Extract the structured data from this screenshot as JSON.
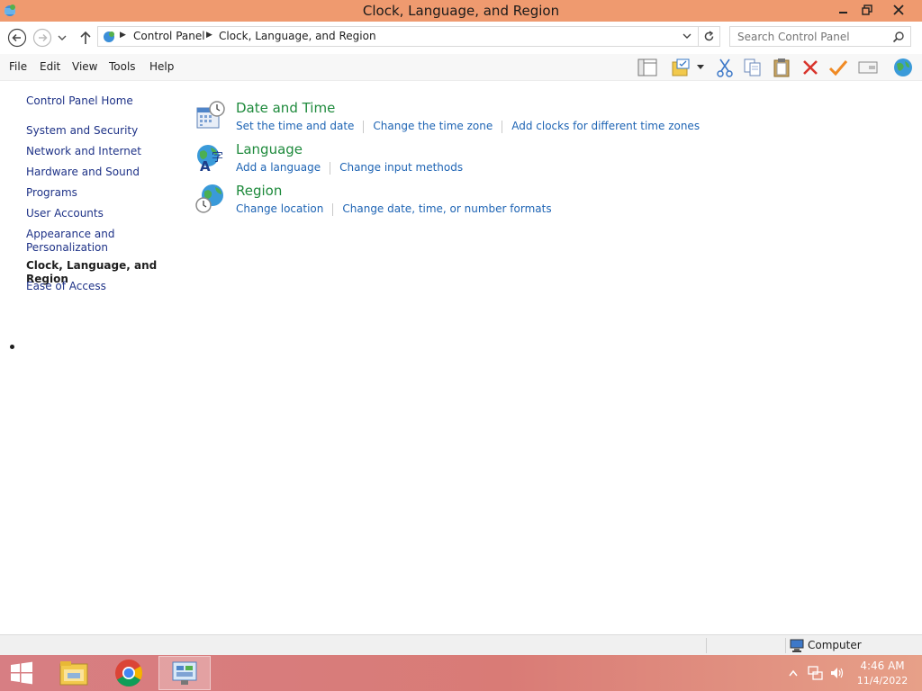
{
  "window": {
    "title": "Clock, Language, and Region",
    "app_icon": "control-panel-icon",
    "controls": [
      "minimize",
      "restore",
      "close"
    ]
  },
  "address_bar": {
    "breadcrumbs": [
      "Control Panel",
      "Clock, Language, and Region"
    ],
    "search_placeholder": "Search Control Panel"
  },
  "menu": {
    "items": [
      "File",
      "Edit",
      "View",
      "Tools",
      "Help"
    ]
  },
  "toolbar": {
    "icons": [
      "layout-pane-icon",
      "folder-view-icon",
      "cut-icon",
      "copy-icon",
      "paste-icon",
      "delete-icon",
      "checkmark-icon",
      "properties-icon",
      "globe-icon"
    ]
  },
  "sidebar": {
    "home": "Control Panel Home",
    "items": [
      "System and Security",
      "Network and Internet",
      "Hardware and Sound",
      "Programs",
      "User Accounts",
      "Appearance and",
      "Personalization",
      "Clock, Language, and Region",
      "Ease of Access"
    ]
  },
  "categories": [
    {
      "title": "Date and Time",
      "icon": "calendar-clock-icon",
      "links": [
        "Set the time and date",
        "Change the time zone",
        "Add clocks for different time zones"
      ]
    },
    {
      "title": "Language",
      "icon": "language-globe-icon",
      "links": [
        "Add a language",
        "Change input methods"
      ]
    },
    {
      "title": "Region",
      "icon": "region-globe-icon",
      "links": [
        "Change location",
        "Change date, time, or number formats"
      ]
    }
  ],
  "statusbar": {
    "text": "Computer"
  },
  "taskbar": {
    "apps": [
      "file-explorer-icon",
      "chrome-icon",
      "control-panel-icon"
    ],
    "time": "4:46 AM",
    "date": "11/4/2022"
  },
  "colors": {
    "titlebar": "#ef9a6f",
    "category_title": "#1e8a3c",
    "link": "#1e64b4",
    "taskbar": "#d77e83"
  }
}
